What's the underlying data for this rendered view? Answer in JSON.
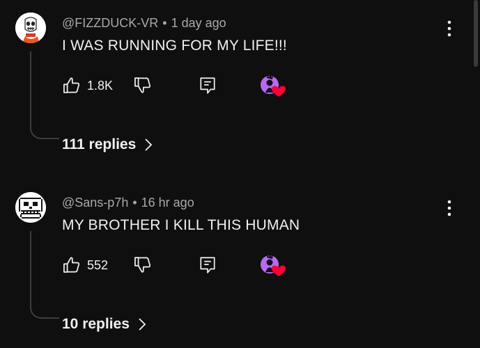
{
  "comments": [
    {
      "author": "@FIZZDUCK-VR",
      "separator": "•",
      "time": "1 day ago",
      "text": "I WAS RUNNING FOR MY LIFE!!!",
      "likes": "1.8K",
      "replies_label": "111 replies",
      "avatar_icon": "papyrus-avatar-icon",
      "creator_heart": true
    },
    {
      "author": "@Sans-p7h",
      "separator": "•",
      "time": "16 hr ago",
      "text": "MY BROTHER I KILL THIS HUMAN",
      "likes": "552",
      "replies_label": "10 replies",
      "avatar_icon": "sans-skull-avatar-icon",
      "creator_heart": true
    }
  ],
  "colors": {
    "background": "#0f0f0f",
    "text": "#f1f1f1",
    "meta": "#aaaaaa",
    "heart": "#ff0033",
    "creator_avatar": "#b56bf0"
  }
}
